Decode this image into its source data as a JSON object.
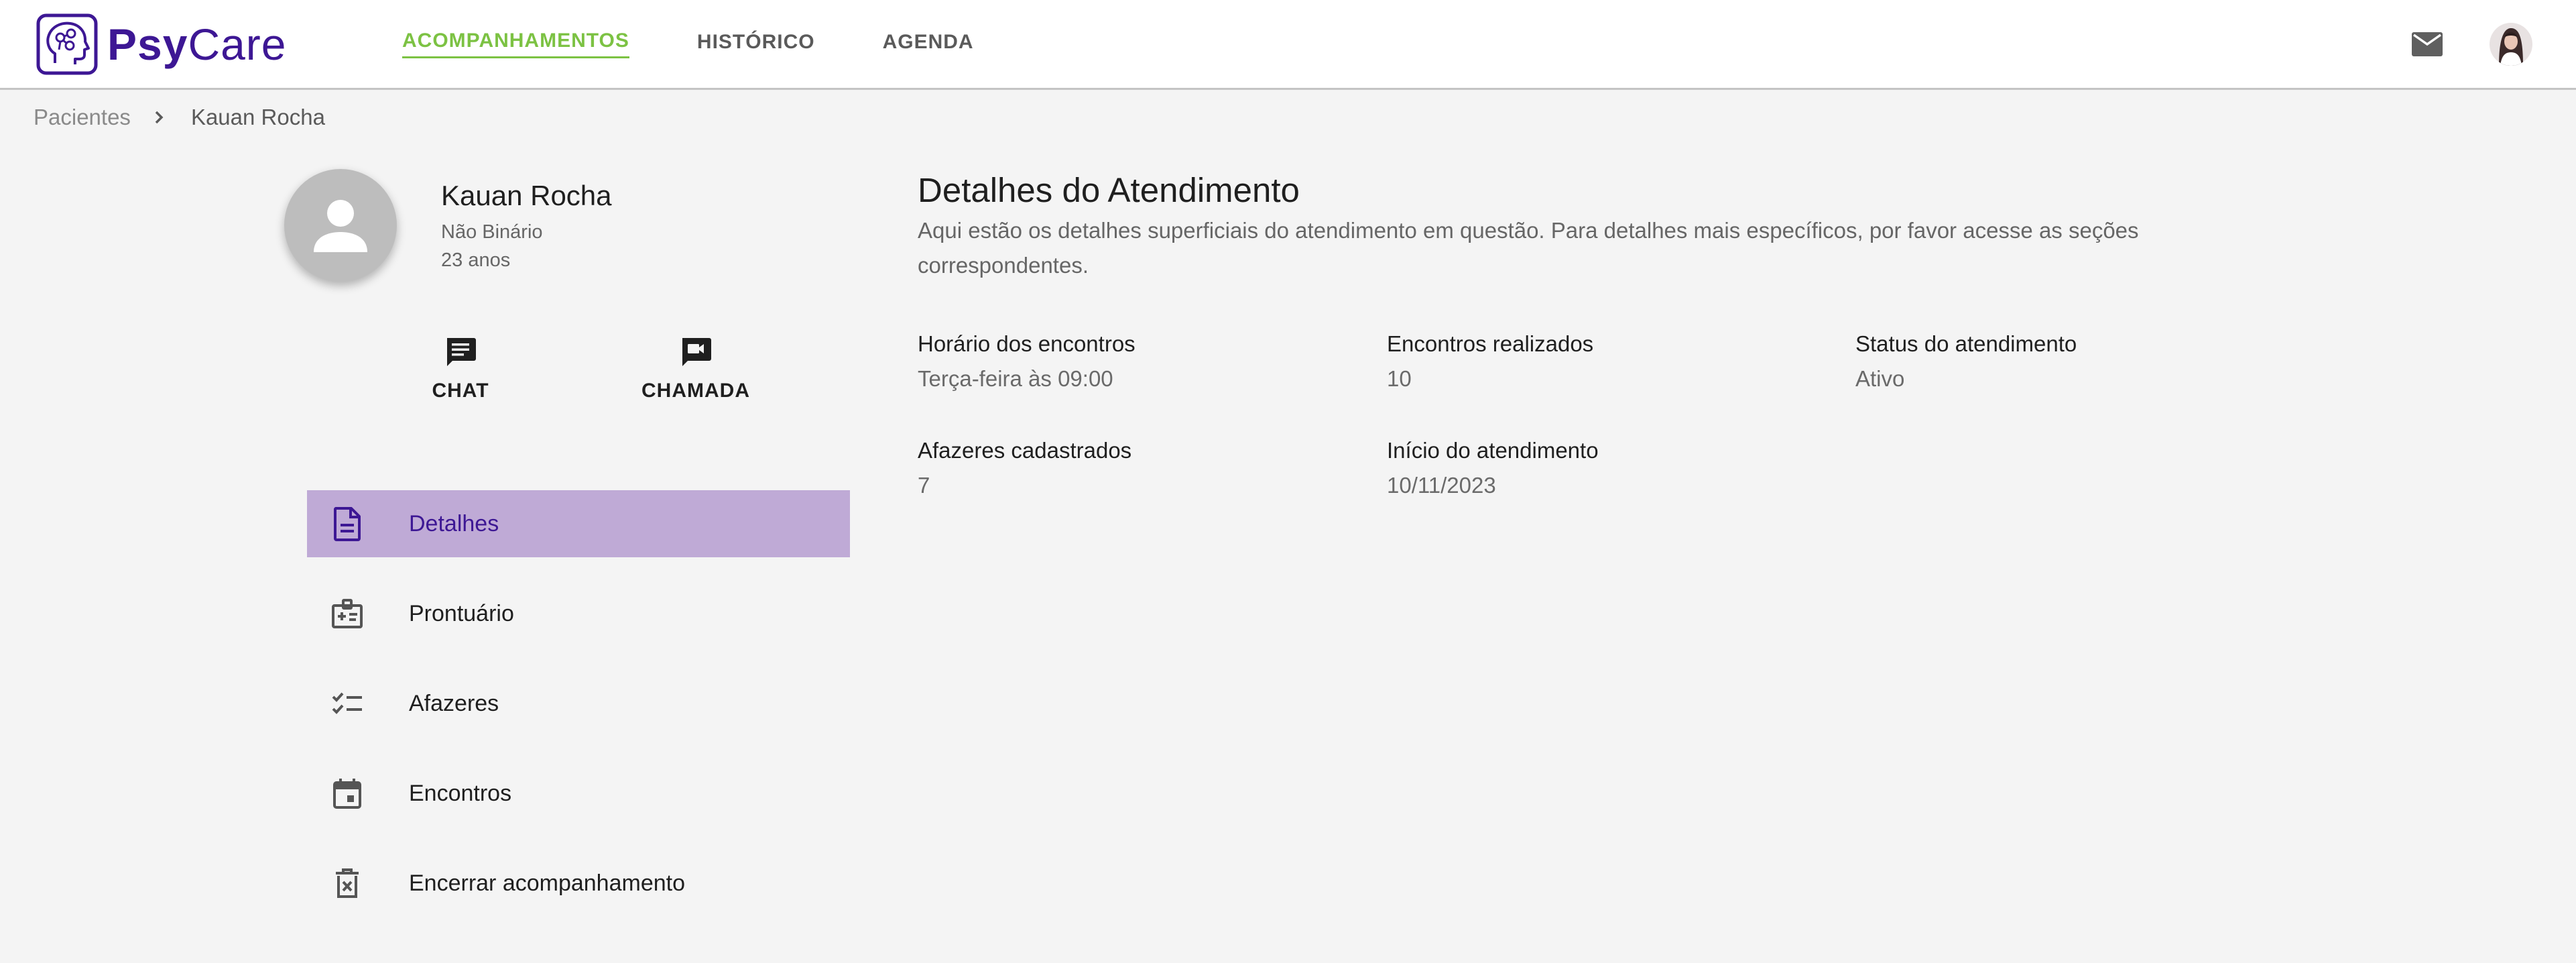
{
  "app": {
    "logo_bold": "Psy",
    "logo_regular": "Care"
  },
  "nav": {
    "items": [
      {
        "label": "ACOMPANHAMENTOS",
        "active": true
      },
      {
        "label": "HISTÓRICO",
        "active": false
      },
      {
        "label": "AGENDA",
        "active": false
      }
    ]
  },
  "header_icons": {
    "mail": "mail-icon",
    "avatar": "user-avatar"
  },
  "breadcrumb": {
    "parent": "Pacientes",
    "current": "Kauan Rocha"
  },
  "patient": {
    "name": "Kauan Rocha",
    "gender": "Não Binário",
    "age": "23 anos"
  },
  "actions": {
    "chat": "CHAT",
    "call": "CHAMADA"
  },
  "menu": {
    "items": [
      {
        "label": "Detalhes",
        "icon": "document-icon",
        "active": true
      },
      {
        "label": "Prontuário",
        "icon": "medical-record-icon",
        "active": false
      },
      {
        "label": "Afazeres",
        "icon": "checklist-icon",
        "active": false
      },
      {
        "label": "Encontros",
        "icon": "calendar-icon",
        "active": false
      },
      {
        "label": "Encerrar acompanhamento",
        "icon": "delete-icon",
        "active": false
      }
    ]
  },
  "details": {
    "title": "Detalhes do Atendimento",
    "description": "Aqui estão os detalhes superficiais do atendimento em questão. Para detalhes mais específicos, por favor acesse as seções correspondentes.",
    "fields": [
      {
        "label": "Horário dos encontros",
        "value": "Terça-feira às 09:00"
      },
      {
        "label": "Encontros realizados",
        "value": "10"
      },
      {
        "label": "Status do atendimento",
        "value": "Ativo"
      },
      {
        "label": "Afazeres cadastrados",
        "value": "7"
      },
      {
        "label": "Início do atendimento",
        "value": "10/11/2023"
      }
    ]
  },
  "colors": {
    "brand": "#3d1794",
    "nav_active": "#7cc243",
    "menu_active_bg": "#bfaad6"
  }
}
